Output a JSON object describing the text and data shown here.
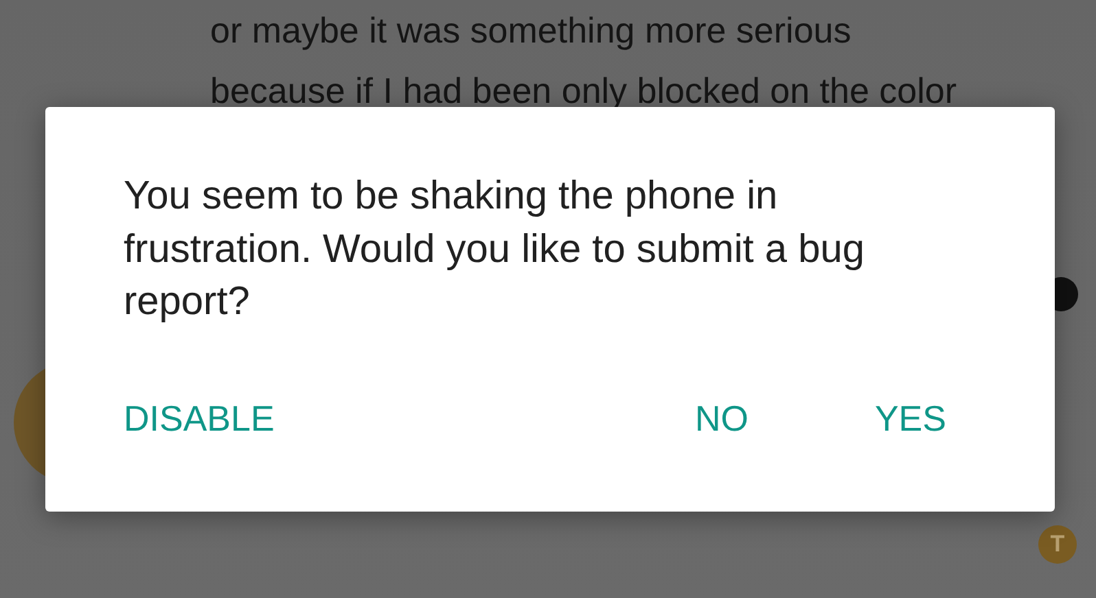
{
  "background_text": [
    "or maybe it was something more serious",
    "because if I had been only blocked on the color"
  ],
  "badge": {
    "label": "T"
  },
  "dialog": {
    "message": "You seem to be shaking the phone in frustration. Would you like to submit a bug report?",
    "buttons": [
      {
        "label": "DISABLE",
        "kind": "left"
      },
      {
        "label": "NO",
        "kind": "right"
      },
      {
        "label": "YES",
        "kind": "right"
      }
    ]
  }
}
